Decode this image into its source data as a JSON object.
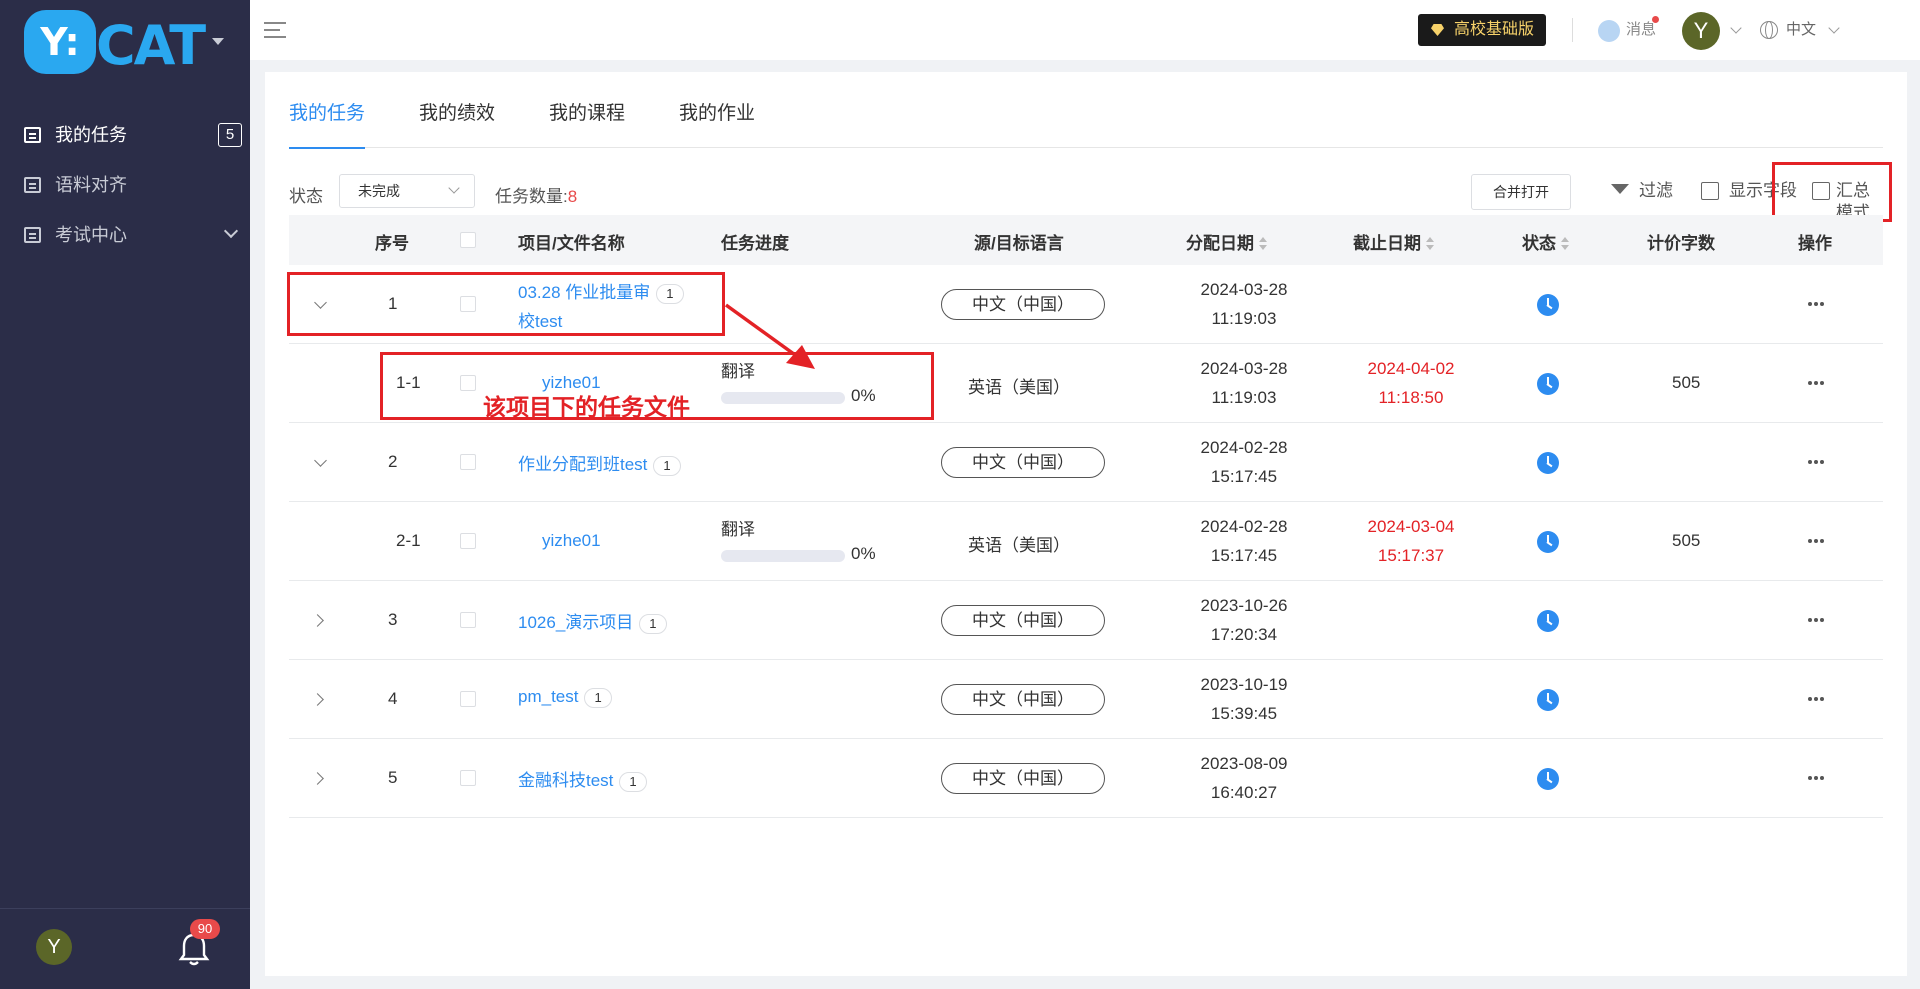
{
  "brand": {
    "mark": "Y:",
    "text": "CAT"
  },
  "sidebar": {
    "items": [
      {
        "label": "我的任务",
        "badge": "5"
      },
      {
        "label": "语料对齐"
      },
      {
        "label": "考试中心"
      }
    ],
    "avatar": "Y",
    "notifications": "90"
  },
  "header": {
    "edition": "高校基础版",
    "messages": "消息",
    "avatar": "Y",
    "language": "中文"
  },
  "tabs": [
    {
      "label": "我的任务",
      "active": true
    },
    {
      "label": "我的绩效"
    },
    {
      "label": "我的课程"
    },
    {
      "label": "我的作业"
    }
  ],
  "toolbar": {
    "status_label": "状态",
    "status_value": "未完成",
    "count_label": "任务数量:",
    "count_value": "8",
    "merge_open": "合并打开",
    "filter": "过滤",
    "show_fields": "显示字段",
    "summary_mode": "汇总模式"
  },
  "table": {
    "headers": {
      "index": "序号",
      "name": "项目/文件名称",
      "progress": "任务进度",
      "language": "源/目标语言",
      "assigned": "分配日期",
      "due": "截止日期",
      "status": "状态",
      "words": "计价字数",
      "actions": "操作"
    },
    "rows": [
      {
        "index": "1",
        "name_line1": "03.28 作业批量审",
        "name_line2": "校test",
        "count": "1",
        "language": "中文（中国）",
        "assigned_date": "2024-03-28",
        "assigned_time": "11:19:03"
      },
      {
        "index": "1-1",
        "name": "yizhe01",
        "progress_label": "翻译",
        "progress_value": "0%",
        "language": "英语（美国）",
        "assigned_date": "2024-03-28",
        "assigned_time": "11:19:03",
        "due_date": "2024-04-02",
        "due_time": "11:18:50",
        "words": "505"
      },
      {
        "index": "2",
        "name": "作业分配到班test",
        "count": "1",
        "language": "中文（中国）",
        "assigned_date": "2024-02-28",
        "assigned_time": "15:17:45"
      },
      {
        "index": "2-1",
        "name": "yizhe01",
        "progress_label": "翻译",
        "progress_value": "0%",
        "language": "英语（美国）",
        "assigned_date": "2024-02-28",
        "assigned_time": "15:17:45",
        "due_date": "2024-03-04",
        "due_time": "15:17:37",
        "words": "505"
      },
      {
        "index": "3",
        "name": "1026_演示项目",
        "count": "1",
        "language": "中文（中国）",
        "assigned_date": "2023-10-26",
        "assigned_time": "17:20:34"
      },
      {
        "index": "4",
        "name": "pm_test",
        "count": "1",
        "language": "中文（中国）",
        "assigned_date": "2023-10-19",
        "assigned_time": "15:39:45"
      },
      {
        "index": "5",
        "name": "金融科技test",
        "count": "1",
        "language": "中文（中国）",
        "assigned_date": "2023-08-09",
        "assigned_time": "16:40:27"
      }
    ]
  },
  "annotation": "该项目下的任务文件",
  "colors": {
    "accent": "#2d8cf0",
    "sidebar": "#2b2d48",
    "highlight": "#e32226"
  }
}
